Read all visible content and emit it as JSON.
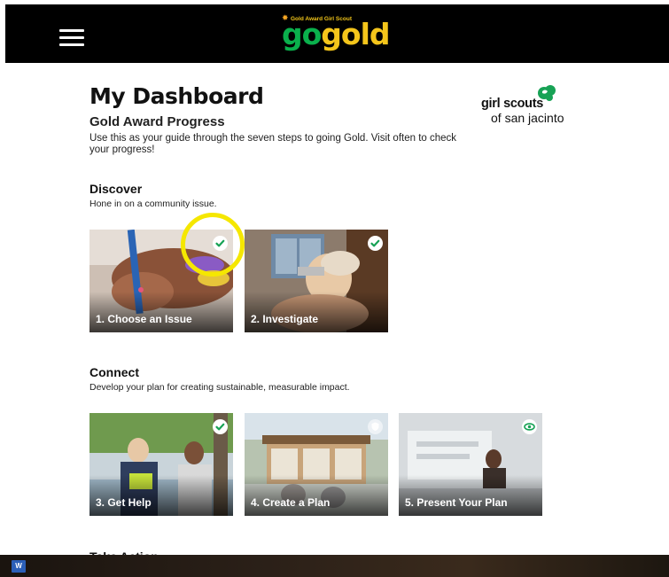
{
  "header": {
    "logo_tagline": "Gold Award Girl Scout",
    "logo_go": "go",
    "logo_gold": "gold"
  },
  "dashboard": {
    "title": "My Dashboard",
    "subtitle": "Gold Award Progress",
    "intro": "Use this as your guide through the seven steps to going Gold.  Visit often to check your progress!"
  },
  "council_logo": {
    "line1": "girl scouts",
    "line2": "of san jacinto"
  },
  "sections": [
    {
      "title": "Discover",
      "description": "Hone in on a community issue.",
      "steps": [
        {
          "label": "1. Choose an Issue",
          "status": "complete",
          "status_icon": "check-icon"
        },
        {
          "label": "2. Investigate",
          "status": "complete",
          "status_icon": "check-icon"
        }
      ]
    },
    {
      "title": "Connect",
      "description": "Develop your plan for creating sustainable, measurable impact.",
      "steps": [
        {
          "label": "3. Get Help",
          "status": "complete",
          "status_icon": "check-icon"
        },
        {
          "label": "4. Create a Plan",
          "status": "not-started",
          "status_icon": "shield-icon"
        },
        {
          "label": "5. Present Your Plan",
          "status": "in-review",
          "status_icon": "eye-icon"
        }
      ]
    }
  ],
  "next_section_title": "Take Action",
  "taskbar": {
    "app_icon": "word-icon",
    "app_letter": "W"
  },
  "colors": {
    "header_bg": "#000000",
    "go_green": "#0ab04c",
    "gold_yellow": "#f4c51b",
    "check_green": "#17a255",
    "highlight_ring": "#f5e700"
  }
}
